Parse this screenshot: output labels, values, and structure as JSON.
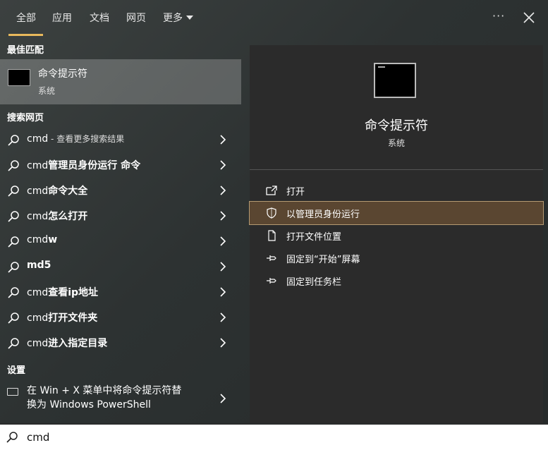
{
  "header": {
    "tabs": [
      {
        "label": "全部",
        "active": true
      },
      {
        "label": "应用"
      },
      {
        "label": "文档"
      },
      {
        "label": "网页"
      },
      {
        "label": "更多"
      }
    ],
    "dots": "···"
  },
  "best_match": {
    "heading": "最佳匹配",
    "title": "命令提示符",
    "subtitle": "系统"
  },
  "web": {
    "heading": "搜索网页",
    "items": [
      {
        "a": "cmd",
        "b": " - 查看更多搜索结果"
      },
      {
        "a": "cmd",
        "b": "管理员身份运行 命令"
      },
      {
        "a": "cmd",
        "b": "命令大全"
      },
      {
        "a": "cmd",
        "b": "怎么打开"
      },
      {
        "a": "cmd",
        "b": "w"
      },
      {
        "a": "",
        "b": "md5"
      },
      {
        "a": "cmd",
        "b": "查看ip地址"
      },
      {
        "a": "cmd",
        "b": "打开文件夹"
      },
      {
        "a": "cmd",
        "b": "进入指定目录"
      }
    ]
  },
  "settings": {
    "heading": "设置",
    "line1": "在 Win + X 菜单中将命令提示符替",
    "line2": "换为 Windows PowerShell"
  },
  "detail": {
    "title": "命令提示符",
    "subtitle": "系统",
    "actions": [
      {
        "label": "打开",
        "icon": "open-icon"
      },
      {
        "label": "以管理员身份运行",
        "icon": "shield-icon",
        "selected": true
      },
      {
        "label": "打开文件位置",
        "icon": "file-location-icon"
      },
      {
        "label": "固定到“开始”屏幕",
        "icon": "pin-icon"
      },
      {
        "label": "固定到任务栏",
        "icon": "pin-icon"
      }
    ]
  },
  "search": {
    "value": "cmd"
  },
  "colors": {
    "accent": "#e8b85c",
    "selected_action": "#5a4631"
  }
}
